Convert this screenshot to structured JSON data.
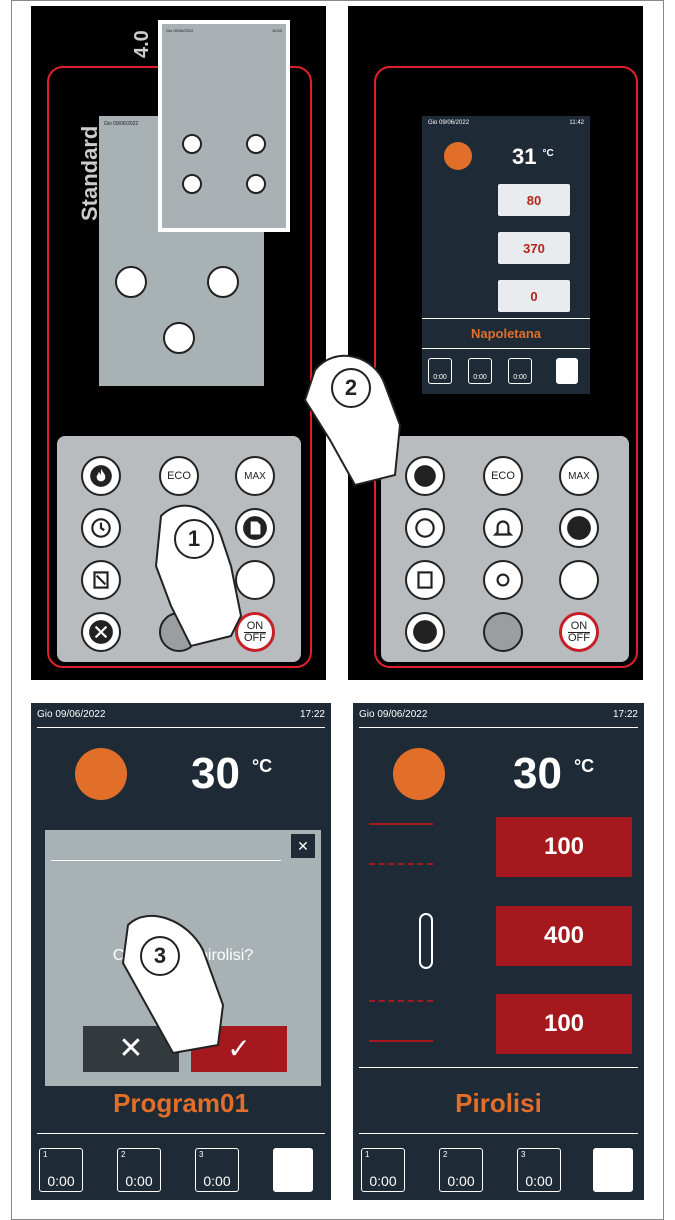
{
  "panel1": {
    "label_40": "4.0",
    "label_standard": "Standard",
    "mini_date": "Gio 09/06/2022",
    "mini_time": "16:53",
    "small_date": "Gio 09/06/2022"
  },
  "panel2": {
    "date": "Gio 09/06/2022",
    "time": "11:42",
    "temp": "31",
    "unit": "°C",
    "v1": "80",
    "v2": "370",
    "v3": "0",
    "prog": "Napoletana",
    "timers": [
      "0:00",
      "0:00",
      "0:00"
    ]
  },
  "keypad": {
    "eco": "ECO",
    "max": "MAX",
    "on": "ON",
    "off": "OFF"
  },
  "steps": [
    "1",
    "2",
    "3"
  ],
  "screen3": {
    "date": "Gio 09/06/2022",
    "time": "17:22",
    "temp": "30",
    "unit": "°C",
    "dialog_text": "Confermi la pirolisi?",
    "prog": "Program01",
    "timers": [
      "0:00",
      "0:00",
      "0:00"
    ],
    "timer_nums": [
      "1",
      "2",
      "3"
    ]
  },
  "screen4": {
    "date": "Gio 09/06/2022",
    "time": "17:22",
    "temp": "30",
    "unit": "°C",
    "v1": "100",
    "v2": "400",
    "v3": "100",
    "prog": "Pirolisi",
    "timers": [
      "0:00",
      "0:00",
      "0:00"
    ],
    "timer_nums": [
      "1",
      "2",
      "3"
    ]
  },
  "colors": {
    "accent": "#e16f2a",
    "red": "#a5191e",
    "outline": "#e0202a",
    "dark": "#1e2a36"
  }
}
